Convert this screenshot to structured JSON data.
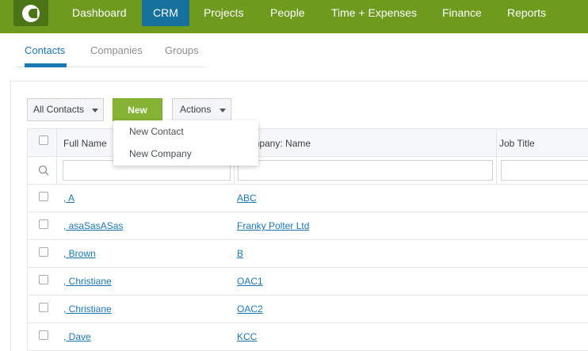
{
  "nav": {
    "items": [
      "Dashboard",
      "CRM",
      "Projects",
      "People",
      "Time + Expenses",
      "Finance",
      "Reports"
    ],
    "active": "CRM"
  },
  "subtabs": {
    "items": [
      "Contacts",
      "Companies",
      "Groups"
    ],
    "active": "Contacts"
  },
  "toolbar": {
    "filter_label": "All Contacts",
    "new_label": "New",
    "actions_label": "Actions"
  },
  "menu": {
    "items": [
      "New Contact",
      "New Company"
    ]
  },
  "table": {
    "headers": [
      "Full Name",
      "Company: Name",
      "Job Title"
    ],
    "rows": [
      {
        "name": ", A",
        "company": "ABC"
      },
      {
        "name": ", asaSasASas",
        "company": "Franky Polter Ltd"
      },
      {
        "name": ", Brown",
        "company": "B"
      },
      {
        "name": ", Christiane",
        "company": "OAC1"
      },
      {
        "name": ", Christiane",
        "company": "OAC2"
      },
      {
        "name": ", Dave",
        "company": "KCC"
      }
    ]
  },
  "colors": {
    "nav_bg": "#6e9a1e",
    "nav_active": "#16719c",
    "accent_green": "#86b333",
    "link": "#1a77b5"
  }
}
